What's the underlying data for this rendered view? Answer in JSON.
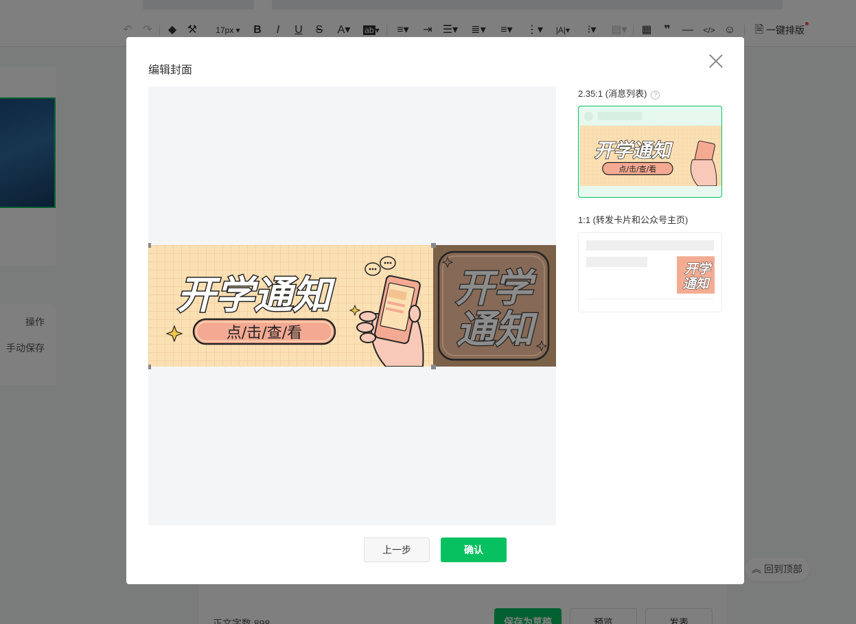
{
  "toolbar": {
    "font_size": "17px",
    "one_click_layout": "一键排版"
  },
  "sidebar": {
    "operation_label": "操作",
    "manual_save_label": "手动保存"
  },
  "footer": {
    "word_count_label": "正文字数",
    "word_count": "898",
    "save_draft_label": "保存为草稿",
    "preview_label": "预览",
    "publish_label": "发表",
    "back_to_top_label": "回到顶部"
  },
  "dialog": {
    "title": "编辑封面",
    "ratio_list_label": "2.35:1 (消息列表)",
    "ratio_square_label": "1:1 (转发卡片和公众号主页)",
    "prev_button": "上一步",
    "confirm_button": "确认"
  },
  "cover_image": {
    "main_text": "开学通知",
    "sub_text": "点/击/查/看",
    "square_text_line1": "开学",
    "square_text_line2": "通知"
  },
  "colors": {
    "accent": "#07c160",
    "banner_bg": "#fbe0b4",
    "pill": "#f4a992",
    "square_bg": "#866956"
  }
}
